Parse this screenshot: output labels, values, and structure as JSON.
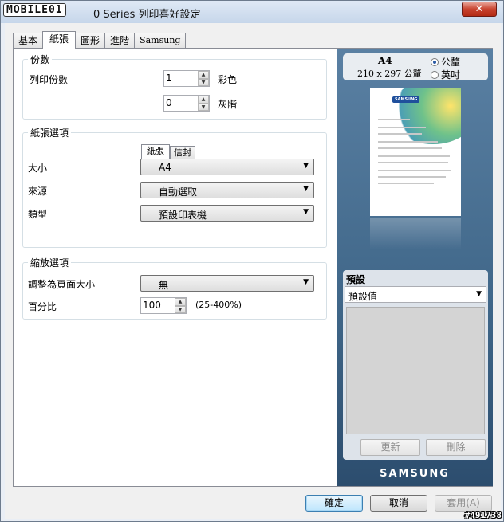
{
  "window": {
    "title_logo": "MOBILE01",
    "title": "0 Series 列印喜好設定",
    "close_glyph": "✕"
  },
  "tabs": [
    "基本",
    "紙張",
    "圖形",
    "進階",
    "Samsung"
  ],
  "copies": {
    "group_label": "份數",
    "label": "列印份數",
    "color_value": "1",
    "color_label": "彩色",
    "gray_value": "0",
    "gray_label": "灰階"
  },
  "paper_options": {
    "group_label": "紙張選項",
    "subtabs": [
      "紙張",
      "信封"
    ],
    "size_label": "大小",
    "size_value": "A4",
    "source_label": "來源",
    "source_value": "自動選取",
    "type_label": "類型",
    "type_value": "預設印表機"
  },
  "scaling": {
    "group_label": "縮放選項",
    "fit_label": "調整為頁面大小",
    "fit_value": "無",
    "percent_label": "百分比",
    "percent_value": "100",
    "percent_range": "(25-400%)"
  },
  "preview": {
    "paper_name": "A4",
    "paper_dims": "210 x 297 公釐",
    "unit_metric": "公釐",
    "unit_inch": "英吋",
    "unit_selected": "metric",
    "thumb_brand": "SAMSUNG",
    "favorites_label": "預設",
    "favorites_value": "預設值",
    "update_button": "更新",
    "delete_button": "刪除",
    "brand": "SAMSUNG"
  },
  "footer": {
    "ok": "確定",
    "cancel": "取消",
    "apply": "套用(A)"
  },
  "watermark": "#491738",
  "colors": {
    "preview_bg": "#3f6688",
    "default_button_border": "#3c7fb1",
    "close_button": "#c8432f"
  }
}
